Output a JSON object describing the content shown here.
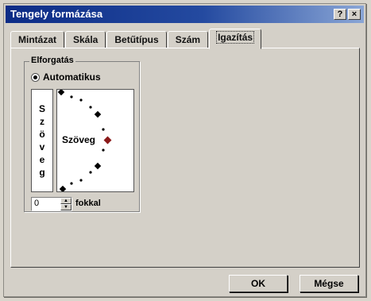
{
  "window": {
    "title": "Tengely formázása",
    "help_label": "?",
    "close_label": "×"
  },
  "tabs": [
    {
      "label": "Mintázat",
      "active": false
    },
    {
      "label": "Skála",
      "active": false
    },
    {
      "label": "Betűtípus",
      "active": false
    },
    {
      "label": "Szám",
      "active": false
    },
    {
      "label": "Igazítás",
      "active": true
    }
  ],
  "alignment": {
    "group_label": "Elforgatás",
    "auto_radio_label": "Automatikus",
    "vertical_text": [
      "S",
      "z",
      "ö",
      "v",
      "e",
      "g"
    ],
    "dial_text": "Szöveg",
    "degrees_value": "0",
    "degrees_label": "fokkal"
  },
  "buttons": {
    "ok_label": "OK",
    "cancel_label": "Mégse"
  },
  "colors": {
    "accent": "#0c2c86",
    "dial_marker": "#8b1a1a"
  }
}
